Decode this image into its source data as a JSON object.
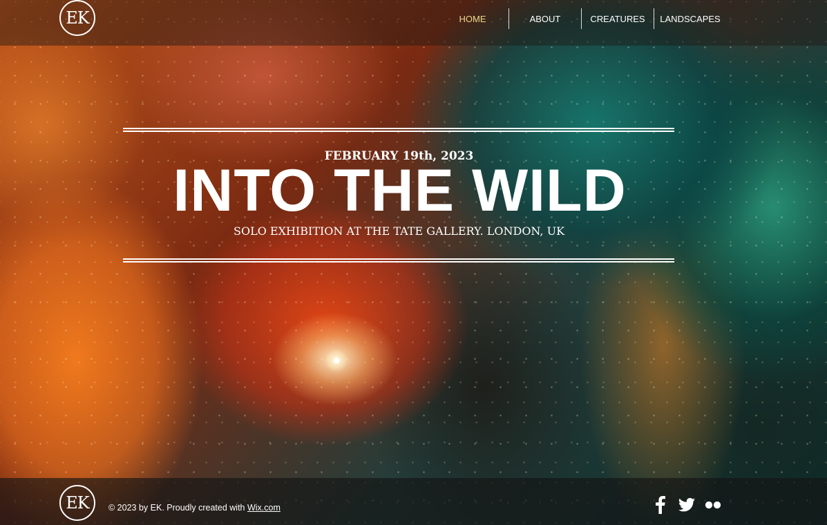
{
  "header": {
    "logo_text": "EK",
    "nav": [
      {
        "label": "HOME",
        "active": true
      },
      {
        "label": "ABOUT",
        "active": false
      },
      {
        "label": "CREATURES",
        "active": false
      },
      {
        "label": "LANDSCAPES",
        "active": false
      }
    ]
  },
  "hero": {
    "date": "FEBRUARY 19th, 2023",
    "title": "INTO THE WILD",
    "subtitle": "SOLO EXHIBITION AT THE TATE GALLERY. LONDON, UK"
  },
  "footer": {
    "logo_text": "EK",
    "copyright_text": "© 2023 by EK. Proudly created with ",
    "link_text": "Wix.com",
    "social": [
      {
        "icon": "facebook-icon"
      },
      {
        "icon": "twitter-icon"
      },
      {
        "icon": "flickr-icon"
      }
    ]
  },
  "colors": {
    "active_nav": "#f0d78a",
    "text": "#ffffff"
  }
}
